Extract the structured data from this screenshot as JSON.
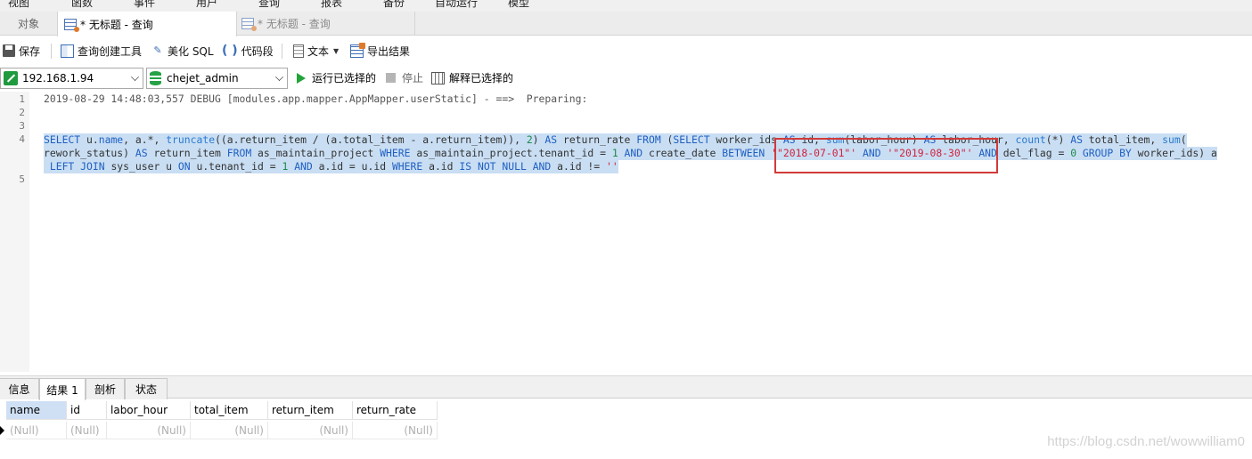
{
  "menu": [
    "视图",
    "函数",
    "事件",
    "用户",
    "查询",
    "报表",
    "备份",
    "自动运行",
    "模型"
  ],
  "tabs": {
    "objects": "对象",
    "active_query": "* 无标题 - 查询",
    "inactive_query": "* 无标题 - 查询"
  },
  "toolbar": {
    "save": "保存",
    "query_builder": "查询创建工具",
    "beautify": "美化 SQL",
    "snippet": "代码段",
    "text": "文本",
    "export": "导出结果"
  },
  "connection": {
    "host": "192.168.1.94",
    "database": "chejet_admin",
    "run_selected": "运行已选择的",
    "stop": "停止",
    "explain_selected": "解释已选择的"
  },
  "editor": {
    "line_numbers": [
      "1",
      "2",
      "3",
      "4",
      "5"
    ],
    "line1": "2019-08-29 14:48:03,557 DEBUG [modules.app.mapper.AppMapper.userStatic] - ==>  Preparing:",
    "line4_a": [
      [
        "kw",
        "SELECT"
      ],
      [
        "plain",
        " u."
      ],
      [
        "kw",
        "name"
      ],
      [
        "plain",
        ", a.*, "
      ],
      [
        "fn",
        "truncate"
      ],
      [
        "plain",
        "((a.return_item / (a.total_item - a.return_item)), "
      ],
      [
        "num",
        "2"
      ],
      [
        "plain",
        ") "
      ],
      [
        "kw",
        "AS"
      ],
      [
        "plain",
        " return_rate "
      ],
      [
        "kw",
        "FROM"
      ],
      [
        "plain",
        " ("
      ],
      [
        "kw",
        "SELECT"
      ],
      [
        "plain",
        " worker_ids "
      ],
      [
        "kw",
        "AS"
      ],
      [
        "plain",
        " id, "
      ],
      [
        "fn",
        "sum"
      ],
      [
        "plain",
        "(labor_hour) "
      ],
      [
        "kw",
        "AS"
      ],
      [
        "plain",
        " labor_hour, "
      ],
      [
        "fn",
        "count"
      ],
      [
        "plain",
        "(*) "
      ],
      [
        "kw",
        "AS"
      ],
      [
        "plain",
        " total_item, "
      ],
      [
        "fn",
        "sum"
      ],
      [
        "plain",
        "("
      ]
    ],
    "line4_b": [
      [
        "plain",
        "rework_status) "
      ],
      [
        "kw",
        "AS"
      ],
      [
        "plain",
        " return_item "
      ],
      [
        "kw",
        "FROM"
      ],
      [
        "plain",
        " as_maintain_project "
      ],
      [
        "kw",
        "WHERE"
      ],
      [
        "plain",
        " as_maintain_project.tenant_id = "
      ],
      [
        "num",
        "1"
      ],
      [
        "plain",
        " "
      ],
      [
        "kw",
        "AND"
      ],
      [
        "plain",
        " create_date "
      ],
      [
        "kw",
        "BETWEEN"
      ],
      [
        "plain",
        " "
      ],
      [
        "str",
        "'\"2018-07-01\"'"
      ],
      [
        "plain",
        " "
      ],
      [
        "kw",
        "AND"
      ],
      [
        "plain",
        " "
      ],
      [
        "str",
        "'\"2019-08-30\"'"
      ],
      [
        "plain",
        " "
      ],
      [
        "kw",
        "AND"
      ],
      [
        "plain",
        " del_flag = "
      ],
      [
        "num",
        "0"
      ],
      [
        "plain",
        " "
      ],
      [
        "kw",
        "GROUP BY"
      ],
      [
        "plain",
        " worker_ids) a"
      ]
    ],
    "line4_c": [
      [
        "plain",
        " "
      ],
      [
        "kw",
        "LEFT JOIN"
      ],
      [
        "plain",
        " sys_user u "
      ],
      [
        "kw",
        "ON"
      ],
      [
        "plain",
        " u.tenant_id = "
      ],
      [
        "num",
        "1"
      ],
      [
        "plain",
        " "
      ],
      [
        "kw",
        "AND"
      ],
      [
        "plain",
        " a.id = u.id "
      ],
      [
        "kw",
        "WHERE"
      ],
      [
        "plain",
        " a.id "
      ],
      [
        "kw",
        "IS NOT NULL"
      ],
      [
        "plain",
        " "
      ],
      [
        "kw",
        "AND"
      ],
      [
        "plain",
        " a.id != "
      ],
      [
        "str",
        "''"
      ]
    ]
  },
  "result_tabs": [
    "信息",
    "结果 1",
    "剖析",
    "状态"
  ],
  "grid": {
    "columns": [
      "name",
      "id",
      "labor_hour",
      "total_item",
      "return_item",
      "return_rate"
    ],
    "row": [
      "(Null)",
      "(Null)",
      "(Null)",
      "(Null)",
      "(Null)",
      "(Null)"
    ]
  },
  "watermark": "https://blog.csdn.net/wowwilliam0"
}
